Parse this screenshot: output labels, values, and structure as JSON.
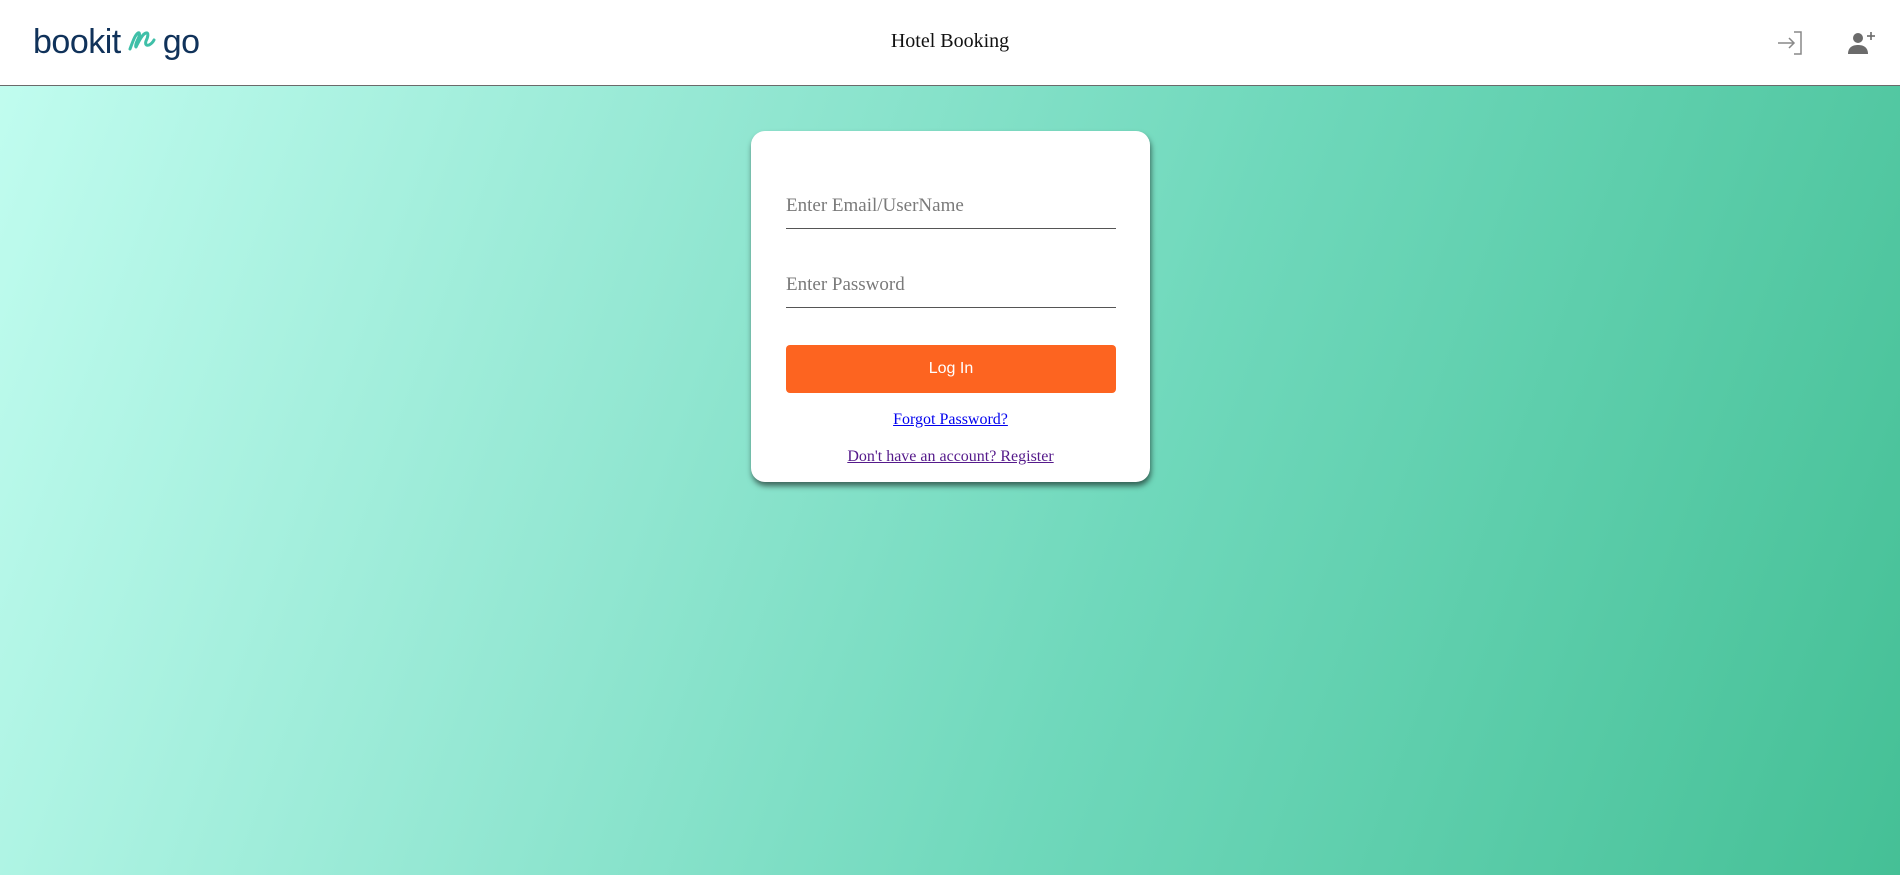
{
  "header": {
    "logo_left": "bookit",
    "logo_right": "go",
    "title": "Hotel Booking",
    "icons": {
      "login": "login-icon",
      "register": "person-add-icon"
    }
  },
  "login_form": {
    "email_placeholder": "Enter Email/UserName",
    "password_placeholder": "Enter Password",
    "login_button_label": "Log In",
    "forgot_password_link": "Forgot Password?",
    "register_link": "Don't have an account? Register"
  },
  "colors": {
    "brand_navy": "#10325a",
    "brand_teal": "#3fbfa8",
    "login_button": "#fd6420",
    "background_start": "#c2fdf0",
    "background_end": "#45c096",
    "link_blue": "#0000ee",
    "link_visited": "#551a8b"
  }
}
